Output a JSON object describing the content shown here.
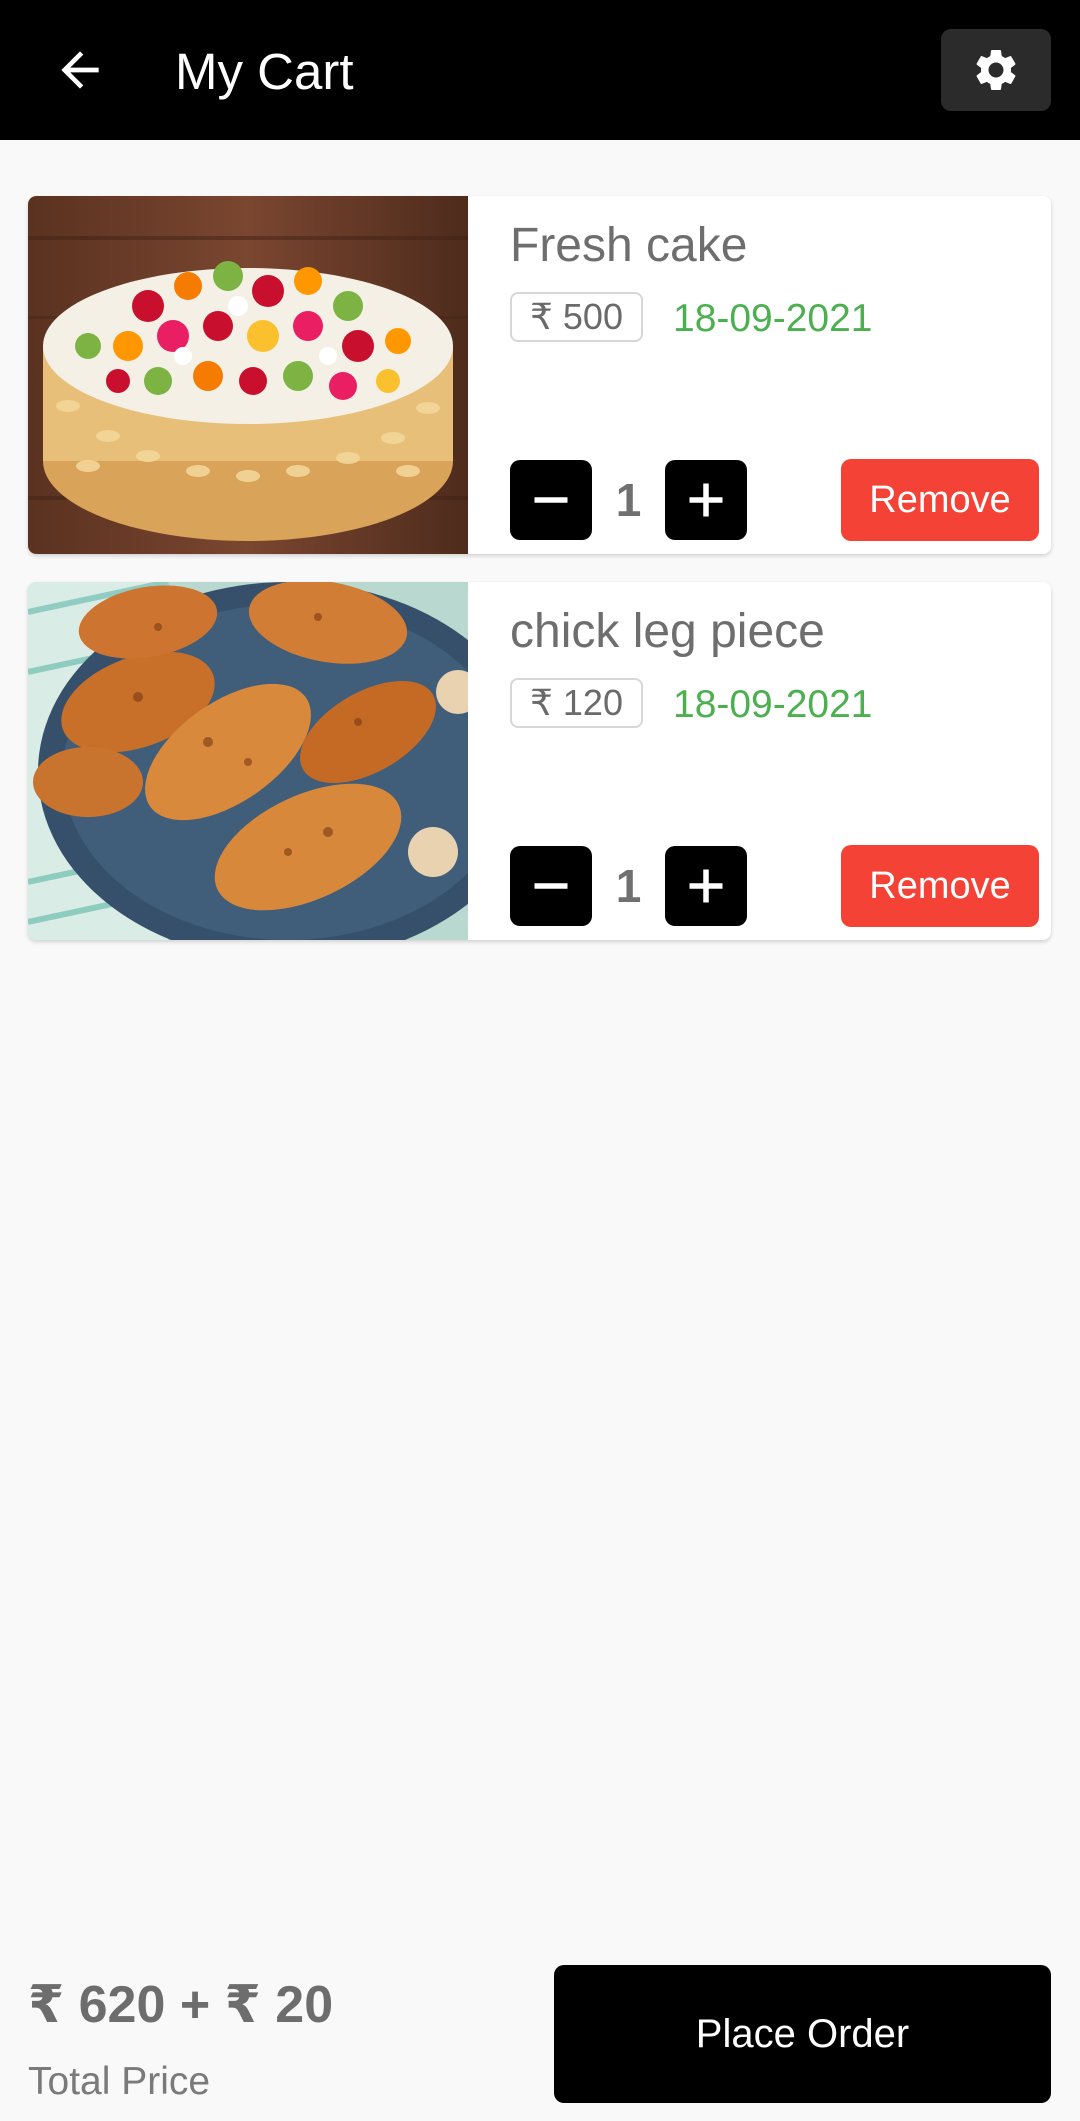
{
  "header": {
    "title": "My Cart",
    "back_icon": "arrow-left-icon",
    "settings_icon": "gear-icon"
  },
  "cart_items": [
    {
      "name": "Fresh cake",
      "price": "₹ 500",
      "date": "18-09-2021",
      "quantity": "1",
      "remove_label": "Remove",
      "image": "fruit-cake-image"
    },
    {
      "name": "chick leg piece",
      "price": "₹ 120",
      "date": "18-09-2021",
      "quantity": "1",
      "remove_label": "Remove",
      "image": "chicken-legs-image"
    }
  ],
  "footer": {
    "total": "₹ 620 +  ₹ 20",
    "total_label": "Total Price",
    "place_order_label": "Place Order"
  },
  "colors": {
    "header_bg": "#000000",
    "date_green": "#4caf50",
    "remove_red": "#f44336",
    "page_bg": "#f9f9f9"
  }
}
